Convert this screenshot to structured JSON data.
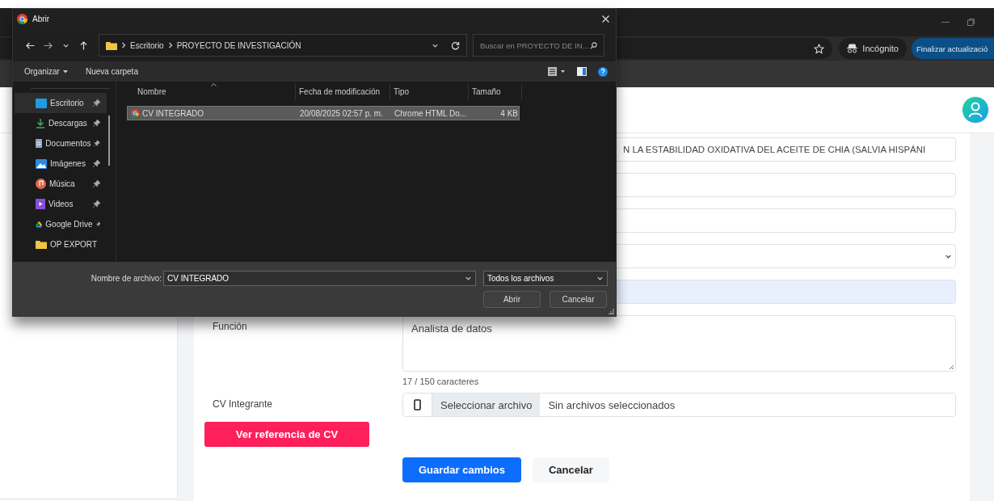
{
  "browser": {
    "incognito_label": "Incógnito",
    "update_button": "Finalizar actualizació"
  },
  "form": {
    "fields": [
      {
        "kind": "text",
        "value": "N LA ESTABILIDAD OXIDATIVA DEL ACEITE DE CHIA (SALVIA HISPÁNI",
        "autofilled": false
      },
      {
        "kind": "text",
        "autofilled": false
      },
      {
        "kind": "text",
        "autofilled": false
      },
      {
        "kind": "select",
        "autofilled": false
      },
      {
        "kind": "text",
        "autofilled": true
      }
    ],
    "function_field": {
      "label": "Función",
      "value": "Analista de datos",
      "counter": "17 / 150 caracteres"
    },
    "cv_field": {
      "label": "CV Integrante",
      "button": "Seleccionar archivo",
      "status": "Sin archivos seleccionados"
    },
    "reference_button": "Ver referencia de CV",
    "buttons": [
      {
        "label": "Guardar cambios",
        "kind": "primary"
      },
      {
        "label": "Cancelar",
        "kind": "secondary"
      }
    ]
  },
  "dialog": {
    "title": "Abrir",
    "breadcrumbs": [
      "Escritorio",
      "PROYECTO DE INVESTIGACIÓN"
    ],
    "search_placeholder": "Buscar en PROYECTO DE IN...",
    "toolbar": [
      "Organizar",
      "Nueva carpeta"
    ],
    "nav": [
      {
        "label": "Escritorio",
        "kind": "desktop",
        "selected": true,
        "pinned": true
      },
      {
        "label": "Descargas",
        "kind": "download",
        "selected": false,
        "pinned": true
      },
      {
        "label": "Documentos",
        "kind": "document",
        "selected": false,
        "pinned": true
      },
      {
        "label": "Imágenes",
        "kind": "pictures",
        "selected": false,
        "pinned": true
      },
      {
        "label": "Música",
        "kind": "music",
        "selected": false,
        "pinned": true
      },
      {
        "label": "Videos",
        "kind": "videos",
        "selected": false,
        "pinned": true
      },
      {
        "label": "Google Drive",
        "kind": "drive",
        "selected": false,
        "pinned": true
      },
      {
        "label": "OP EXPORT",
        "kind": "folder",
        "selected": false,
        "pinned": false
      }
    ],
    "columns": [
      "Nombre",
      "Fecha de modificación",
      "Tipo",
      "Tamaño"
    ],
    "rows": [
      {
        "name": "CV INTEGRADO",
        "date": "20/08/2025 02:57 p. m.",
        "type": "Chrome HTML Do...",
        "size": "4 KB",
        "selected": true
      }
    ],
    "filename_label": "Nombre de archivo:",
    "filename": "CV INTEGRADO",
    "filetype": "Todos los archivos",
    "buttons": [
      "Abrir",
      "Cancelar"
    ]
  }
}
